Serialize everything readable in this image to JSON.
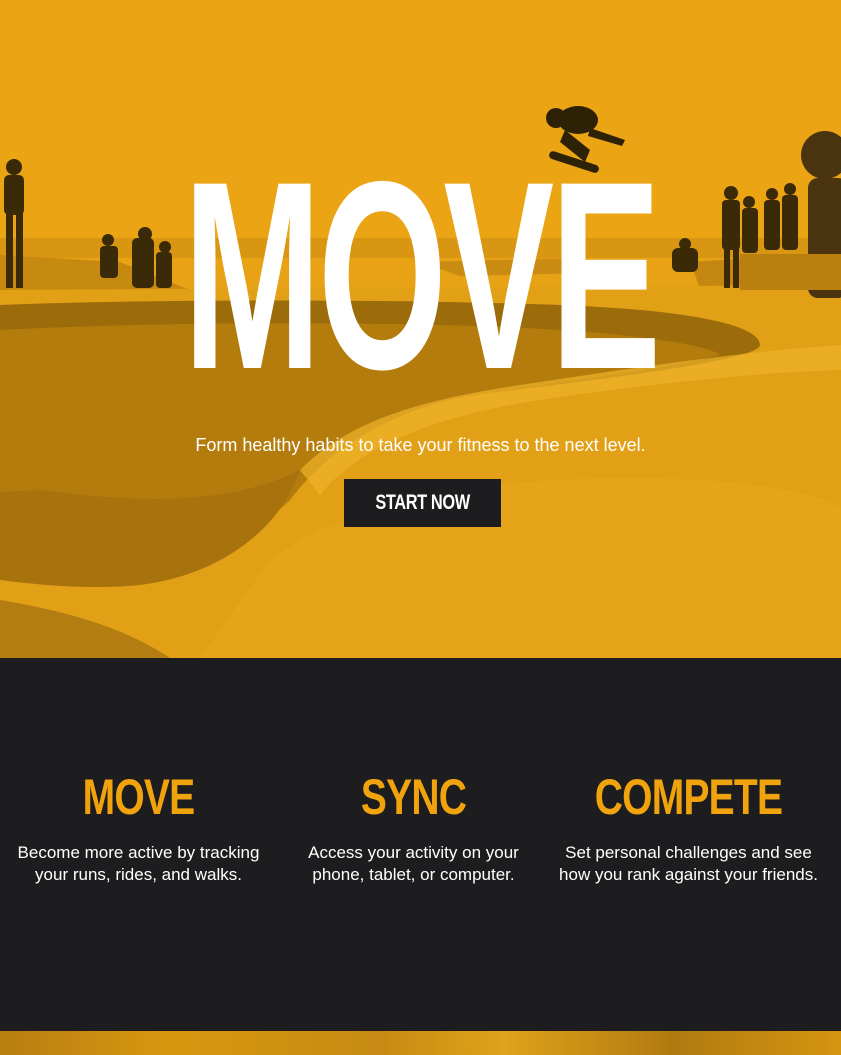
{
  "hero": {
    "title": "MOVE",
    "tagline": "Form healthy habits to take your fitness to the next level.",
    "cta_label": "START NOW",
    "accent_color": "#e9a313"
  },
  "features": [
    {
      "title": "MOVE",
      "text": "Become more active by tracking your runs, rides, and walks."
    },
    {
      "title": "SYNC",
      "text": "Access your activity on your phone, tablet, or computer."
    },
    {
      "title": "COMPETE",
      "text": "Set personal challenges and see how you rank against your friends."
    }
  ],
  "colors": {
    "accent": "#f0a30c",
    "dark": "#1d1d1f",
    "text_light": "#ffffff"
  }
}
